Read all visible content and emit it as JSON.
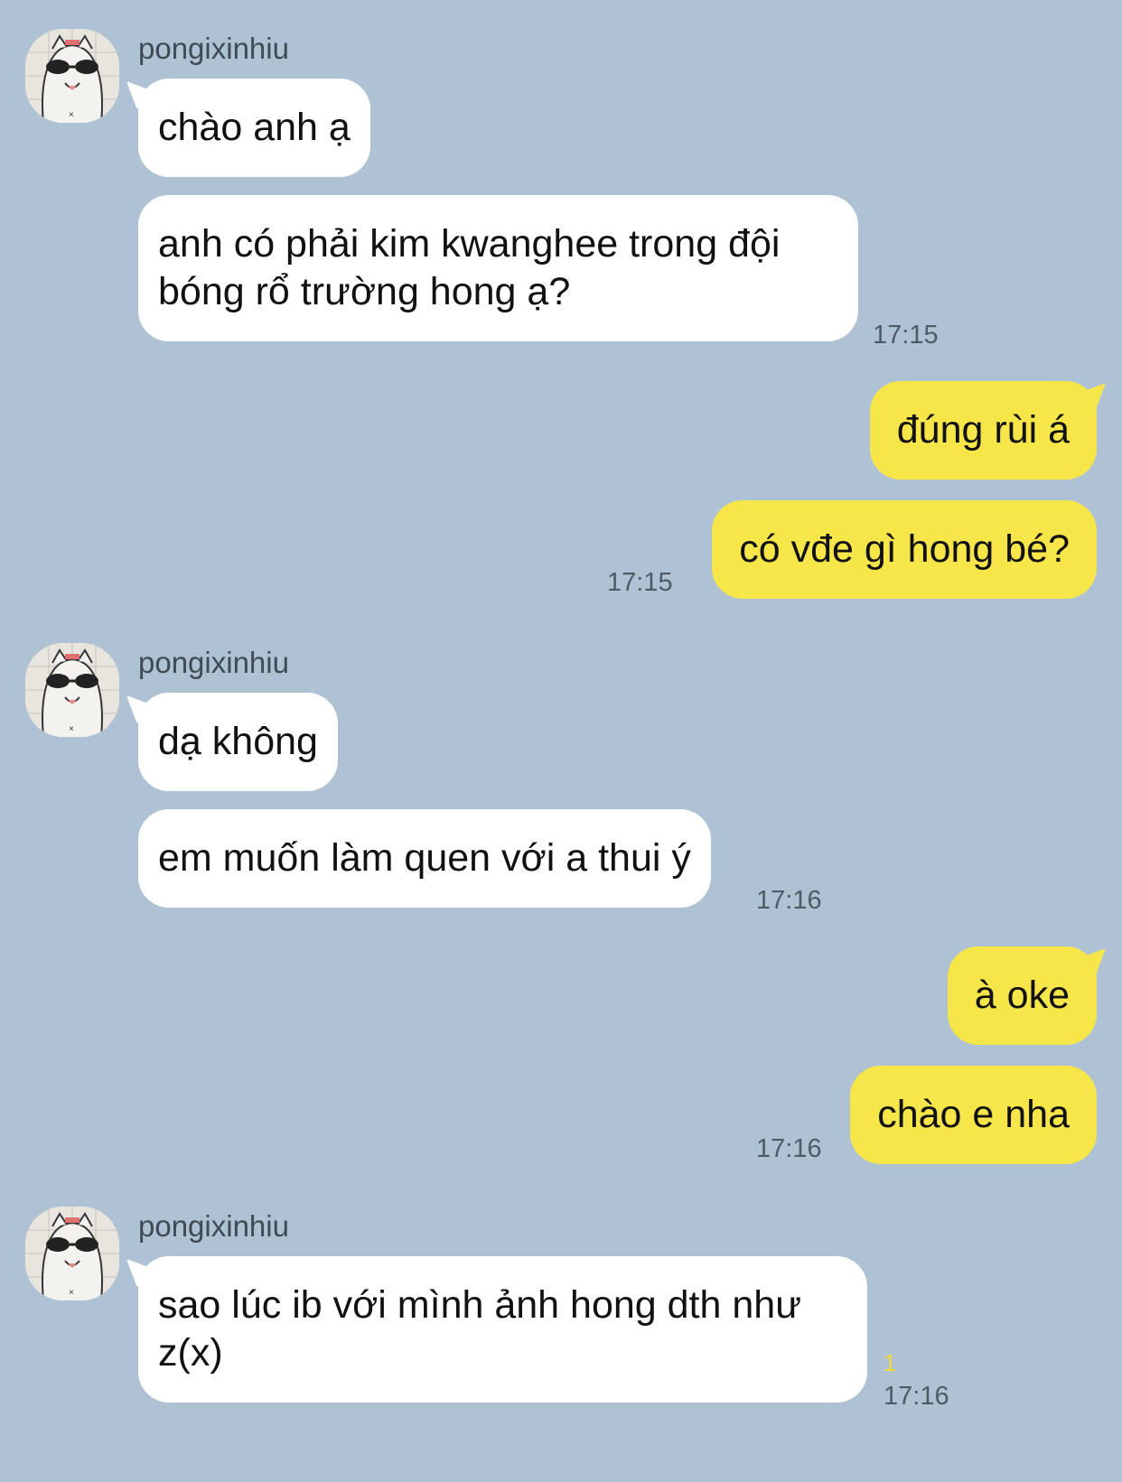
{
  "chat": {
    "sender_name": "pongixinhiu",
    "messages": {
      "m1": "chào anh ạ",
      "m2_line1": "anh có phải kim kwanghee trong đội",
      "m2_line2": "bóng rổ trường hong ạ?",
      "m3": "đúng rùi á",
      "m4": "có vđe gì hong bé?",
      "m5": "dạ không",
      "m6": "em muốn làm quen với a thui ý",
      "m7": "à oke",
      "m8": "chào e nha",
      "m9_line1": "sao lúc ib với mình ảnh hong dth như",
      "m9_line2": "z(x)"
    },
    "times": {
      "t1": "17:15",
      "t2": "17:15",
      "t3": "17:16",
      "t4": "17:16",
      "t5": "17:16"
    },
    "unread_count": "1",
    "icons": {
      "avatar": "cat-with-sunglasses-avatar"
    },
    "colors": {
      "background": "#AFC2D3",
      "incoming_bubble": "#FFFFFF",
      "outgoing_bubble": "#F7E64A",
      "unread_indicator": "#F2D836"
    }
  }
}
